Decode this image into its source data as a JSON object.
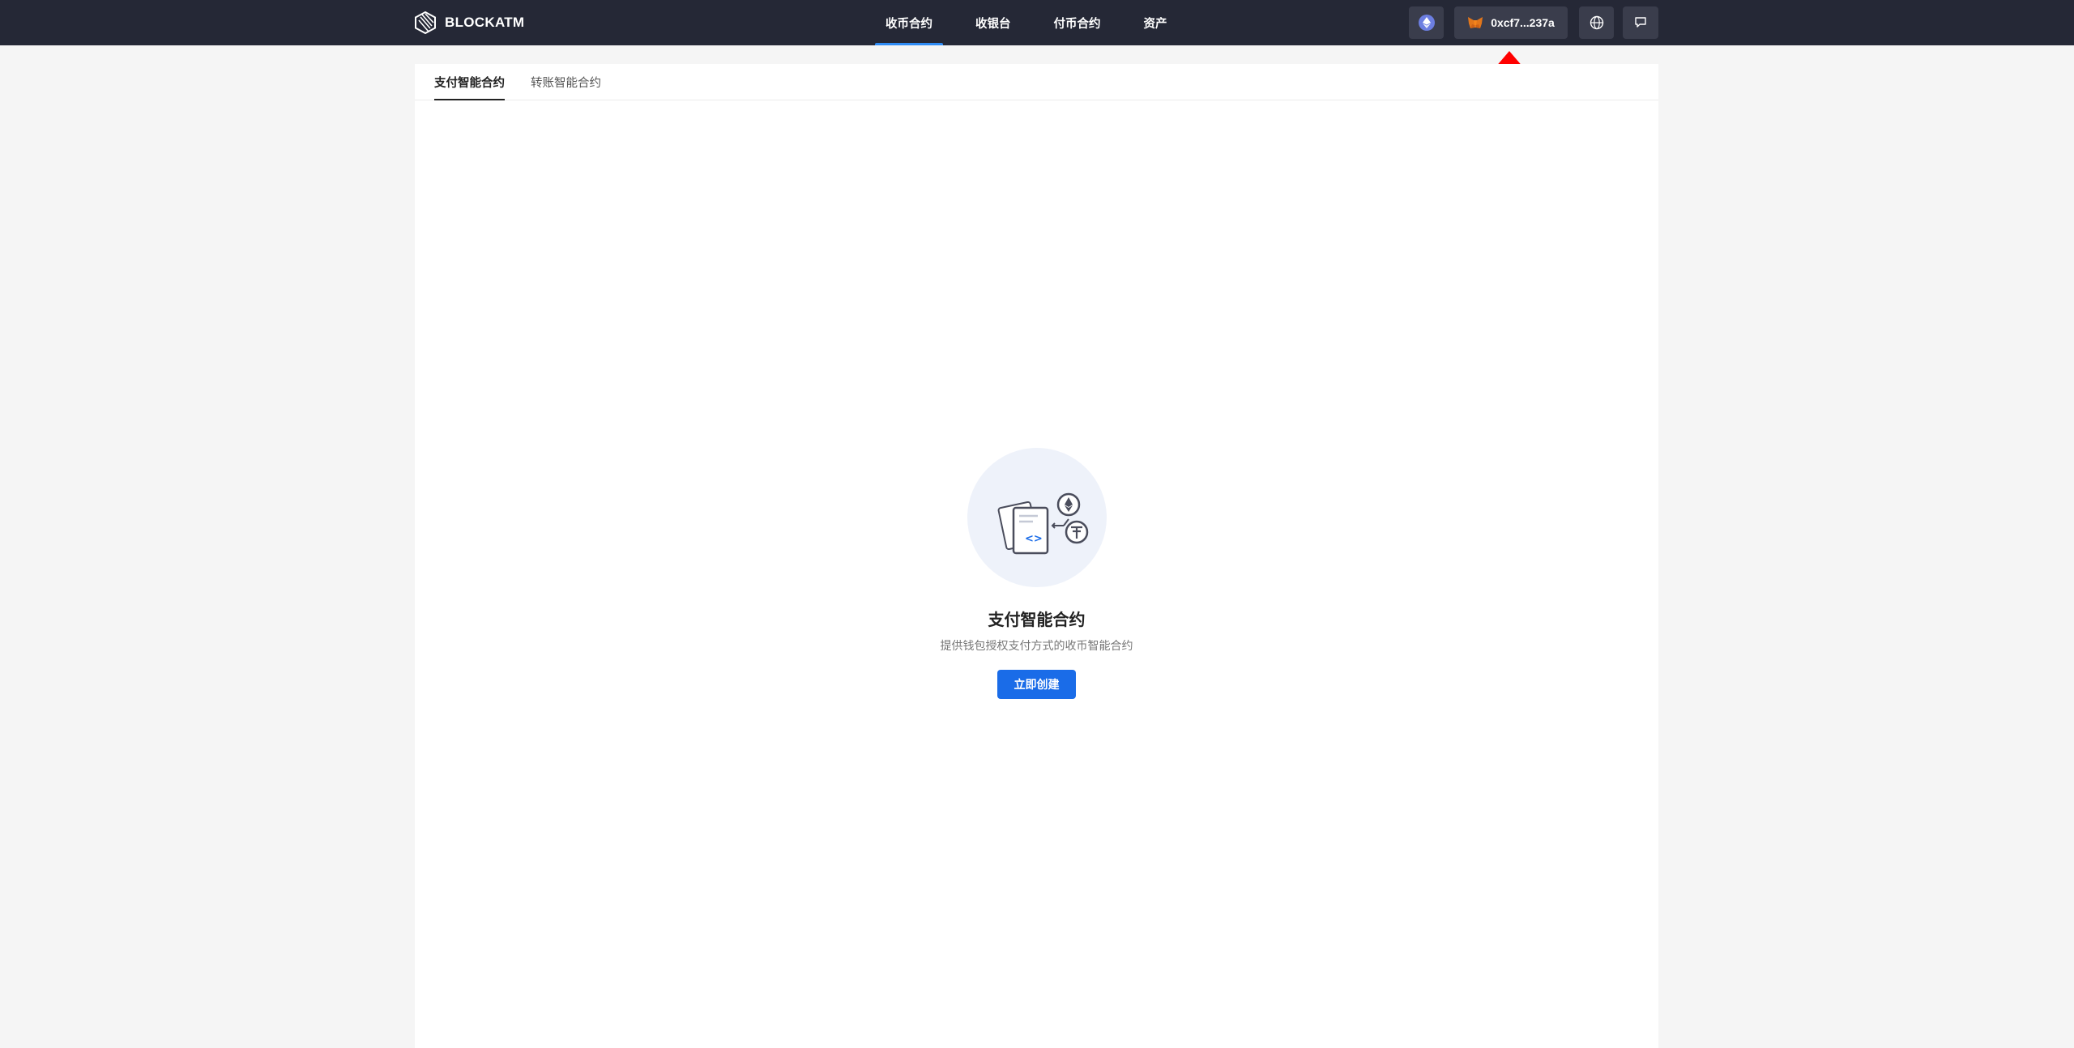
{
  "brand": {
    "name": "BLOCKATM"
  },
  "nav": {
    "items": [
      {
        "label": "收币合约",
        "active": true
      },
      {
        "label": "收银台"
      },
      {
        "label": "付币合约"
      },
      {
        "label": "资产"
      }
    ]
  },
  "header": {
    "wallet_address": "0xcf7...237a",
    "chain_icon": "ethereum-icon",
    "wallet_icon": "metamask-fox-icon",
    "language_icon": "globe-icon",
    "feedback_icon": "feedback-icon"
  },
  "tabs": [
    {
      "label": "支付智能合约",
      "active": true
    },
    {
      "label": "转账智能合约"
    }
  ],
  "empty_state": {
    "title": "支付智能合约",
    "description": "提供钱包授权支付方式的收币智能合约",
    "button_label": "立即创建",
    "illustration_icon": "smart-contract-illustration-icon"
  },
  "colors": {
    "header_bg": "#252836",
    "accent": "#2f8cf5",
    "primary_button": "#1a6ce8",
    "page_bg": "#f5f5f5",
    "annotation_arrow": "#ff0000"
  }
}
